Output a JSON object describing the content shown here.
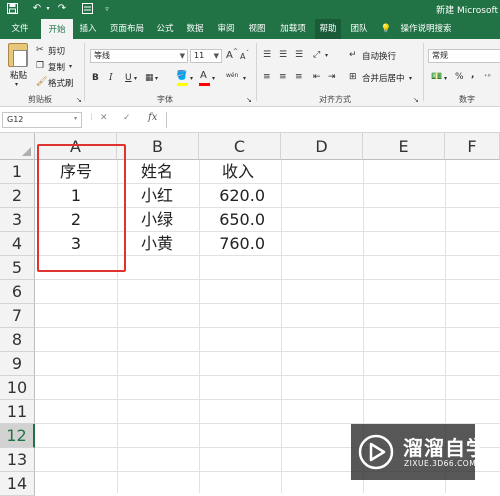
{
  "title_bar": {
    "title": "新建 Microsoft",
    "quick_access": [
      "save-icon",
      "undo-icon",
      "redo-icon",
      "form-icon",
      "customize-icon"
    ]
  },
  "tabs": [
    {
      "label": "文件"
    },
    {
      "label": "开始"
    },
    {
      "label": "插入"
    },
    {
      "label": "页面布局"
    },
    {
      "label": "公式"
    },
    {
      "label": "数据"
    },
    {
      "label": "审阅"
    },
    {
      "label": "视图"
    },
    {
      "label": "加载项"
    },
    {
      "label": "帮助"
    },
    {
      "label": "团队"
    },
    {
      "label": "操作说明搜索"
    }
  ],
  "ribbon": {
    "clipboard": {
      "paste": "粘贴",
      "cut": "剪切",
      "copy": "复制",
      "format_painter": "格式刷",
      "group_label": "剪贴板"
    },
    "font": {
      "font_name": "等线",
      "font_size": "11",
      "bold": "B",
      "italic": "I",
      "underline": "U",
      "grow": "A",
      "shrink": "A",
      "color_a": "A",
      "phonetic": "wén",
      "group_label": "字体"
    },
    "alignment": {
      "wrap_text": "自动换行",
      "merge_center": "合并后居中",
      "group_label": "对齐方式"
    },
    "number": {
      "format": "常规",
      "percent": "%",
      "comma": ",",
      "group_label": "数字"
    }
  },
  "formula_bar": {
    "name_box": "G12",
    "fx": "fx",
    "cancel": "✕",
    "enter": "✓",
    "content": ""
  },
  "sheet": {
    "columns": [
      "A",
      "B",
      "C",
      "D",
      "E",
      "F"
    ],
    "rows": [
      "1",
      "2",
      "3",
      "4",
      "5",
      "6",
      "7",
      "8",
      "9",
      "10",
      "11",
      "12",
      "13",
      "14"
    ],
    "selected_row": "12",
    "cells": {
      "A1": "序号",
      "B1": "姓名",
      "C1": "收入",
      "A2": "1",
      "B2": "小红",
      "C2": "620.0",
      "A3": "2",
      "B3": "小绿",
      "C3": "650.0",
      "A4": "3",
      "B4": "小黄",
      "C4": "760.0"
    }
  },
  "watermark": {
    "title": "溜溜自学",
    "subtitle": "ZIXUE.3D66.COM"
  },
  "colors": {
    "excel_green": "#217346",
    "highlight_red": "#e0322f"
  }
}
